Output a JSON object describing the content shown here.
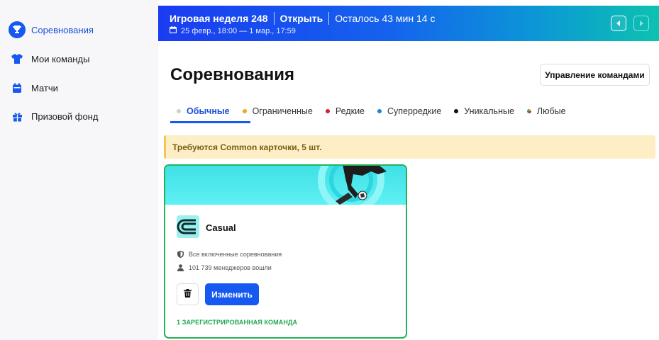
{
  "sidebar": {
    "items": [
      {
        "label": "Соревнования",
        "icon": "trophy-icon",
        "active": true
      },
      {
        "label": "Мои команды",
        "icon": "shirt-icon",
        "active": false
      },
      {
        "label": "Матчи",
        "icon": "calendar-icon",
        "active": false
      },
      {
        "label": "Призовой фонд",
        "icon": "gift-icon",
        "active": false
      }
    ]
  },
  "banner": {
    "title": "Игровая неделя 248",
    "status": "Открыть",
    "countdown": "Осталось 43 мин 14 с",
    "dates": "25 февр., 18:00 — 1 мар., 17:59"
  },
  "header": {
    "title": "Соревнования",
    "manage_button": "Управление командами"
  },
  "tabs": [
    {
      "label": "Обычные",
      "color": "#cfcfcf",
      "active": true
    },
    {
      "label": "Ограниченные",
      "color": "#e8a91e",
      "active": false
    },
    {
      "label": "Редкие",
      "color": "#d3202a",
      "active": false
    },
    {
      "label": "Суперредкие",
      "color": "#1b86d0",
      "active": false
    },
    {
      "label": "Уникальные",
      "color": "#111111",
      "active": false
    },
    {
      "label": "Любые",
      "color": "multicolor",
      "active": false
    }
  ],
  "notice": "Требуются Common карточки, 5 шт.",
  "card": {
    "title": "Casual",
    "scope": "Все включенные соревнования",
    "managers": "101 739 менеджеров вошли",
    "edit_button": "Изменить",
    "registered": "1 ЗАРЕГИСТРИРОВАННАЯ КОМАНДА"
  },
  "colors": {
    "accent": "#1559f0",
    "success": "#21b45a",
    "notice_bg": "#fdeec6"
  }
}
